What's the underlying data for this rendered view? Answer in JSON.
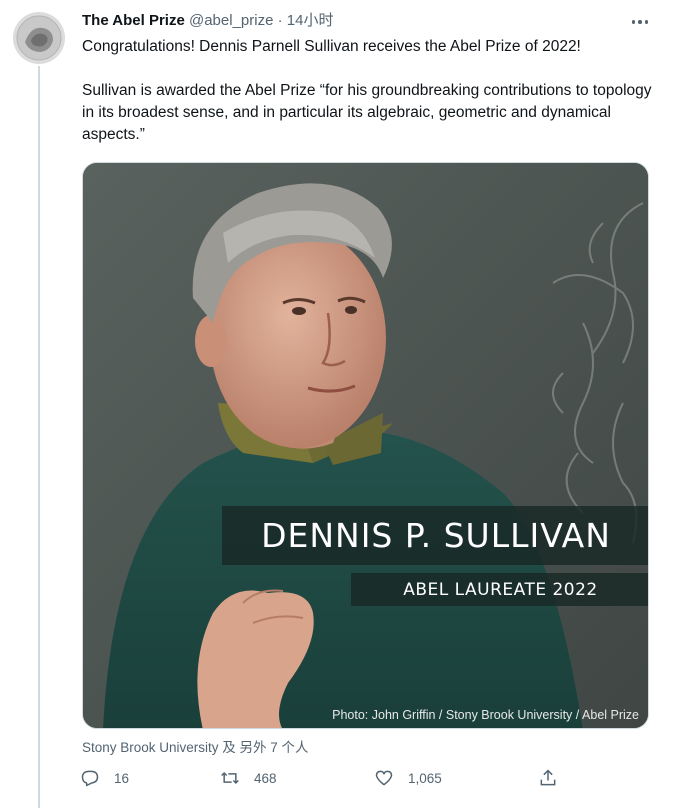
{
  "author": {
    "display_name": "The Abel Prize",
    "handle": "@abel_prize",
    "separator": "·",
    "timestamp": "14小时"
  },
  "tweet": {
    "paragraph_1": "Congratulations! Dennis Parnell Sullivan receives the Abel Prize of 2022!",
    "paragraph_2": "Sullivan is awarded the Abel Prize “for his groundbreaking contributions to topology in its broadest sense, and in particular its algebraic, geometric and dynamical aspects.”"
  },
  "media": {
    "name_banner": "DENNIS P. SULLIVAN",
    "title_banner": "ABEL LAUREATE 2022",
    "photo_credit": "Photo: John Griffin / Stony Brook University / Abel Prize"
  },
  "tagged": "Stony Brook University 及 另外 7 个人",
  "actions": {
    "reply_count": "16",
    "retweet_count": "468",
    "like_count": "1,065"
  },
  "icons": {
    "reply": "reply-icon",
    "retweet": "retweet-icon",
    "like": "heart-icon",
    "share": "share-icon",
    "more": "more-icon"
  }
}
